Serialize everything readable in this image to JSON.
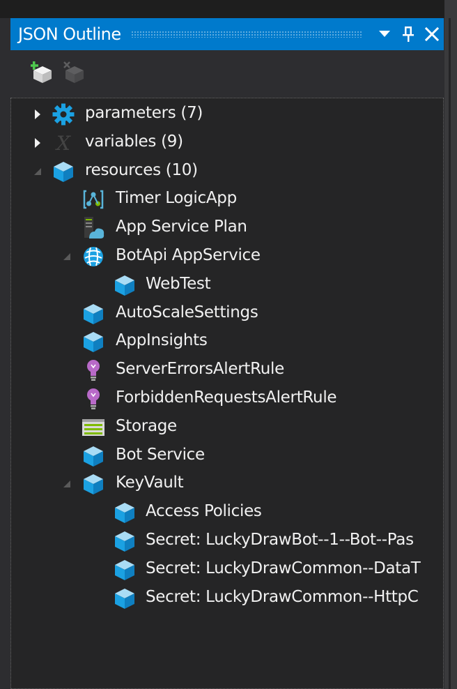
{
  "window": {
    "title": "JSON Outline",
    "buttons": {
      "dropdown_icon": "chevron-down-icon",
      "pin_icon": "pin-icon",
      "close_icon": "close-icon"
    }
  },
  "toolbar": {
    "items": [
      {
        "icon": "add-resource-icon",
        "enabled": true
      },
      {
        "icon": "remove-resource-icon",
        "enabled": false
      }
    ]
  },
  "tree": {
    "nodes": [
      {
        "label": "parameters (7)",
        "icon": "gear-icon",
        "level": 0,
        "expander": "collapsed"
      },
      {
        "label": "variables (9)",
        "icon": "variable-x-icon",
        "level": 0,
        "expander": "collapsed"
      },
      {
        "label": "resources (10)",
        "icon": "cube-icon",
        "level": 0,
        "expander": "expanded"
      },
      {
        "label": "Timer LogicApp",
        "icon": "logic-app-icon",
        "level": 1,
        "expander": "none"
      },
      {
        "label": "App Service Plan",
        "icon": "app-service-plan-icon",
        "level": 1,
        "expander": "none"
      },
      {
        "label": "BotApi AppService",
        "icon": "app-service-icon",
        "level": 1,
        "expander": "expanded"
      },
      {
        "label": "WebTest",
        "icon": "cube-icon",
        "level": 2,
        "expander": "none"
      },
      {
        "label": "AutoScaleSettings",
        "icon": "cube-icon",
        "level": 1,
        "expander": "none"
      },
      {
        "label": "AppInsights",
        "icon": "cube-icon",
        "level": 1,
        "expander": "none"
      },
      {
        "label": "ServerErrorsAlertRule",
        "icon": "lightbulb-icon",
        "level": 1,
        "expander": "none"
      },
      {
        "label": "ForbiddenRequestsAlertRule",
        "icon": "lightbulb-icon",
        "level": 1,
        "expander": "none"
      },
      {
        "label": "Storage",
        "icon": "storage-icon",
        "level": 1,
        "expander": "none"
      },
      {
        "label": "Bot Service",
        "icon": "cube-icon",
        "level": 1,
        "expander": "none"
      },
      {
        "label": "KeyVault",
        "icon": "cube-icon",
        "level": 1,
        "expander": "expanded"
      },
      {
        "label": "Access Policies",
        "icon": "cube-icon",
        "level": 2,
        "expander": "none"
      },
      {
        "label": "Secret: LuckyDrawBot--1--Bot--Pas",
        "icon": "cube-icon",
        "level": 2,
        "expander": "none"
      },
      {
        "label": "Secret: LuckyDrawCommon--DataT",
        "icon": "cube-icon",
        "level": 2,
        "expander": "none"
      },
      {
        "label": "Secret: LuckyDrawCommon--HttpC",
        "icon": "cube-icon",
        "level": 2,
        "expander": "none"
      }
    ]
  },
  "colors": {
    "accent": "#007acc",
    "cube_blue": "#1ba1e2",
    "background": "#252526"
  }
}
